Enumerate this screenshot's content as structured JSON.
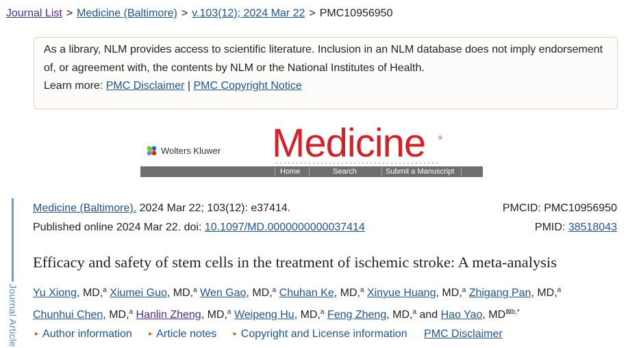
{
  "breadcrumb": {
    "journal_list": "Journal List",
    "journal": "Medicine (Baltimore)",
    "issue": "v.103(12); 2024 Mar 22",
    "current": "PMC10956950",
    "separator": ">"
  },
  "disclaimer": {
    "text": "As a library, NLM provides access to scientific literature. Inclusion in an NLM database does not imply endorsement of, or agreement with, the contents by NLM or the National Institutes of Health.",
    "learn_more": "Learn more:",
    "link1": "PMC Disclaimer",
    "divider": "|",
    "link2": "PMC Copyright Notice"
  },
  "banner": {
    "publisher": "Wolters Kluwer",
    "journal_logo": "Medicine",
    "registered": "®",
    "nav": [
      "Home",
      "Search",
      "Submit a Manuscript"
    ]
  },
  "sidebar": {
    "label": "Journal Article"
  },
  "citation": {
    "journal_link": "Medicine (Baltimore).",
    "date_volume": " 2024 Mar 22; 103(12): e37414.",
    "published_prefix": "Published online 2024 Mar 22. doi: ",
    "doi": "10.1097/MD.0000000000037414",
    "pmcid_label": "PMCID: PMC10956950",
    "pmid_label": "PMID: ",
    "pmid": "38518043"
  },
  "article": {
    "title": "Efficacy and safety of stem cells in the treatment of ischemic stroke: A meta-analysis"
  },
  "authors": [
    {
      "name": "Yu Xiong",
      "degree": ", MD,",
      "aff": "a"
    },
    {
      "name": "Xiumei Guo",
      "degree": ", MD,",
      "aff": "a"
    },
    {
      "name": "Wen Gao",
      "degree": ", MD,",
      "aff": "a"
    },
    {
      "name": "Chuhan Ke",
      "degree": ", MD,",
      "aff": "a"
    },
    {
      "name": "Xinyue Huang",
      "degree": ", MD,",
      "aff": "a"
    },
    {
      "name": "Zhigang Pan",
      "degree": ", MD,",
      "aff": "a"
    },
    {
      "name": "Chunhui Chen",
      "degree": ", MD,",
      "aff": "a"
    },
    {
      "name": "Hanlin Zheng",
      "degree": ", MD,",
      "aff": "a"
    },
    {
      "name": "Weipeng Hu",
      "degree": ", MD,",
      "aff": "a"
    },
    {
      "name": "Feng Zheng",
      "degree": ", MD,",
      "aff": "a"
    },
    {
      "name": "Hao Yao",
      "degree": ", MD",
      "aff": "⊠b,*"
    }
  ],
  "authors_and": "and",
  "info_links": {
    "author_info": "Author information",
    "article_notes": "Article notes",
    "copyright": "Copyright and License information",
    "pmc_disclaimer": "PMC Disclaimer"
  },
  "colors": {
    "link": "#205493",
    "visited": "#4c2c92",
    "brand_red": "#d42026",
    "disclaimer_border": "#e8cdb4"
  }
}
